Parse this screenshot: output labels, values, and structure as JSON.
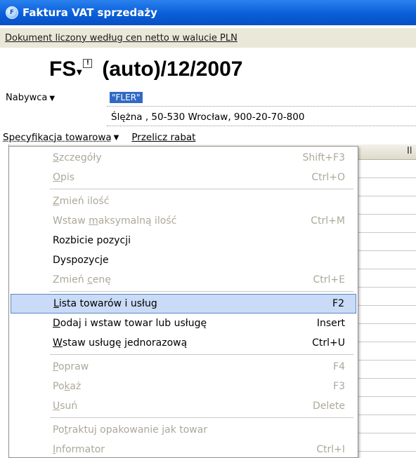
{
  "window": {
    "title": "Faktura VAT sprzedaży"
  },
  "info": {
    "text": "Dokument liczony według cen netto w walucie PLN"
  },
  "document": {
    "prefix": "FS",
    "number_rest": "(auto)/12/2007",
    "note_icon": "!"
  },
  "buyer": {
    "label": "Nabywca",
    "name": "\"FLER\"",
    "address": "Ślężna , 50-530 Wrocław, 900-20-70-800"
  },
  "spec": {
    "label": "Specyfikacja towarowa",
    "recalc_link": "Przelicz rabat"
  },
  "grid": {
    "column_fragment": "Il"
  },
  "menu": {
    "items": [
      {
        "pre": "",
        "u": "S",
        "post": "zczegóły",
        "shortcut": "Shift+F3",
        "enabled": false
      },
      {
        "pre": "",
        "u": "O",
        "post": "pis",
        "shortcut": "Ctrl+O",
        "enabled": false
      },
      {
        "pre": "",
        "u": "Z",
        "post": "mień ilość",
        "shortcut": "",
        "enabled": false
      },
      {
        "pre": "Wstaw ",
        "u": "m",
        "post": "aksymalną ilość",
        "shortcut": "Ctrl+M",
        "enabled": false
      },
      {
        "pre": "Rozbicie pozycji",
        "u": "",
        "post": "",
        "shortcut": "",
        "enabled": true
      },
      {
        "pre": "Dyspozycje",
        "u": "",
        "post": "",
        "shortcut": "",
        "enabled": true
      },
      {
        "pre": "Zmień ",
        "u": "c",
        "post": "enę",
        "shortcut": "Ctrl+E",
        "enabled": false
      },
      {
        "pre": "",
        "u": "L",
        "post": "ista towarów i usług",
        "shortcut": "F2",
        "enabled": true,
        "highlight": true
      },
      {
        "pre": "",
        "u": "D",
        "post": "odaj i wstaw towar lub usługę",
        "shortcut": "Insert",
        "enabled": true
      },
      {
        "pre": "",
        "u": "W",
        "post": "staw usługę jednorazową",
        "shortcut": "Ctrl+U",
        "enabled": true
      },
      {
        "pre": "",
        "u": "P",
        "post": "opraw",
        "shortcut": "F4",
        "enabled": false
      },
      {
        "pre": "Po",
        "u": "k",
        "post": "aż",
        "shortcut": "F3",
        "enabled": false
      },
      {
        "pre": "",
        "u": "U",
        "post": "suń",
        "shortcut": "Delete",
        "enabled": false
      },
      {
        "pre": "Po",
        "u": "t",
        "post": "raktuj opakowanie jak towar",
        "shortcut": "",
        "enabled": false
      },
      {
        "pre": "",
        "u": "I",
        "post": "nformator",
        "shortcut": "Ctrl+I",
        "enabled": false
      }
    ]
  }
}
